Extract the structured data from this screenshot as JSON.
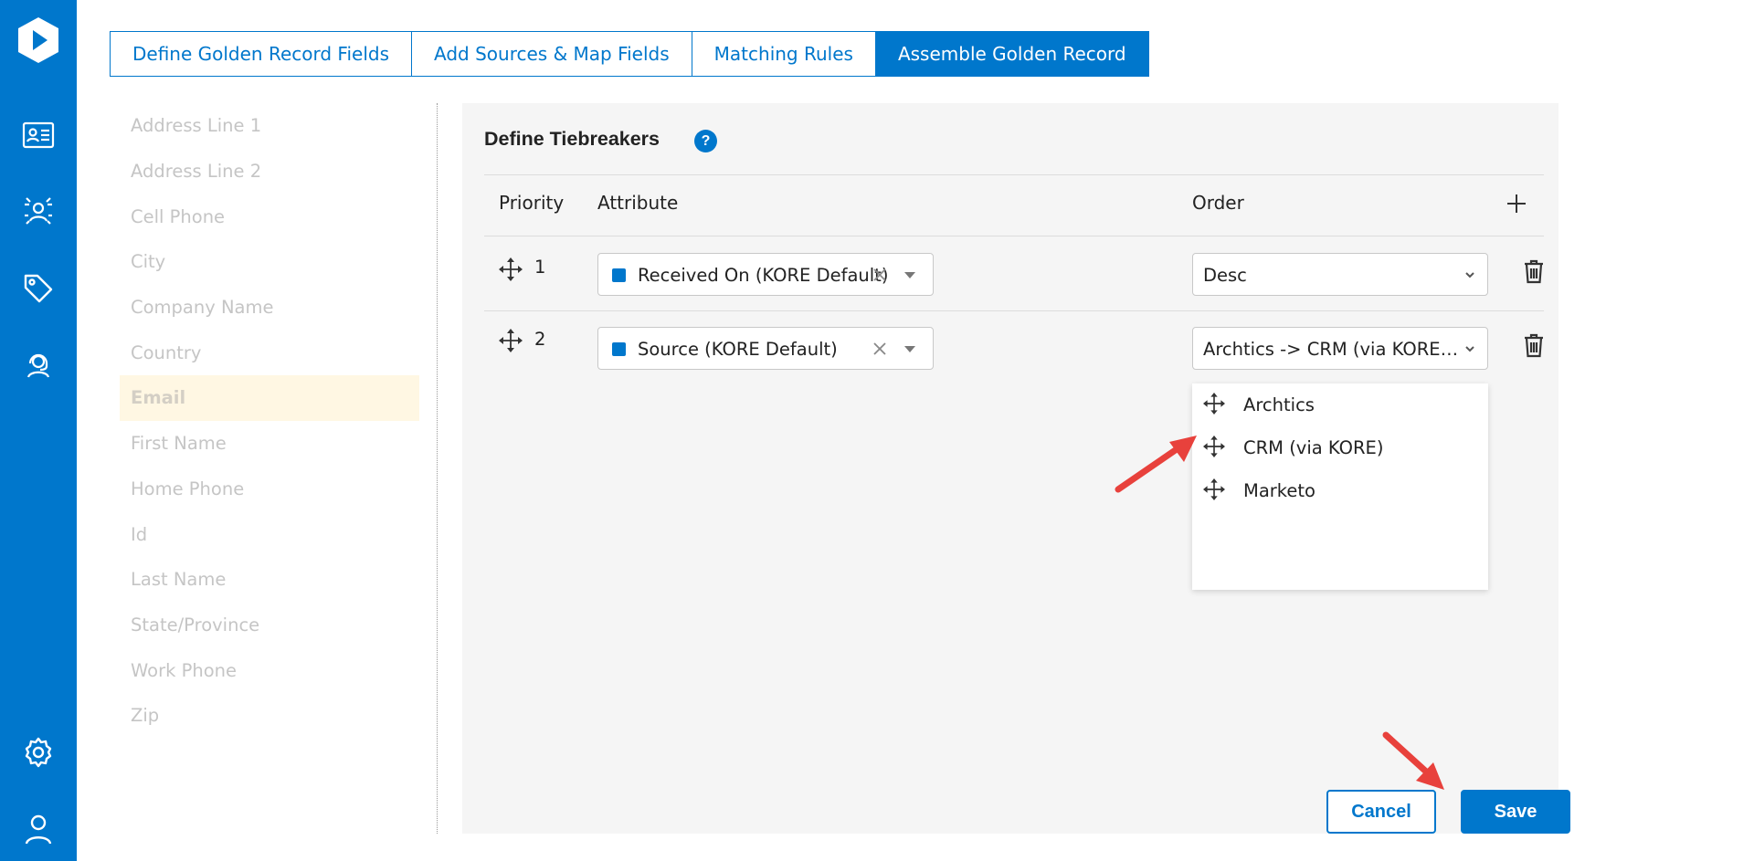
{
  "rail": {
    "logo_icon": "app-logo",
    "items": [
      {
        "name": "contact-card-icon"
      },
      {
        "name": "audience-network-icon"
      },
      {
        "name": "tag-icon"
      },
      {
        "name": "user-support-icon"
      },
      {
        "name": "gear-icon"
      },
      {
        "name": "user-profile-icon"
      }
    ],
    "color": "#0077cc"
  },
  "tabs": [
    {
      "label": "Define Golden Record Fields",
      "active": false
    },
    {
      "label": "Add Sources & Map Fields",
      "active": false
    },
    {
      "label": "Matching Rules",
      "active": false
    },
    {
      "label": "Assemble Golden Record",
      "active": true
    }
  ],
  "fields": [
    "Address Line 1",
    "Address Line 2",
    "Cell Phone",
    "City",
    "Company Name",
    "Country",
    "Email",
    "First Name",
    "Home Phone",
    "Id",
    "Last Name",
    "State/Province",
    "Work Phone",
    "Zip"
  ],
  "selected_field": "Email",
  "panel": {
    "title": "Define Tiebreakers",
    "help_icon": "?",
    "columns": {
      "priority": "Priority",
      "attribute": "Attribute",
      "order": "Order"
    },
    "rows": [
      {
        "priority": "1",
        "attribute": "Received On (KORE Default)",
        "order": "Desc"
      },
      {
        "priority": "2",
        "attribute": "Source (KORE Default)",
        "order": "Archtics -> CRM (via KORE -> Marketo"
      }
    ],
    "order_dropdown": [
      "Archtics",
      "CRM (via KORE)",
      "Marketo"
    ]
  },
  "buttons": {
    "cancel": "Cancel",
    "save": "Save"
  },
  "colors": {
    "accent": "#0077cc",
    "selected_bg": "#fff7e3",
    "panel_bg": "#f5f5f5",
    "annotation": "#e8413c"
  }
}
